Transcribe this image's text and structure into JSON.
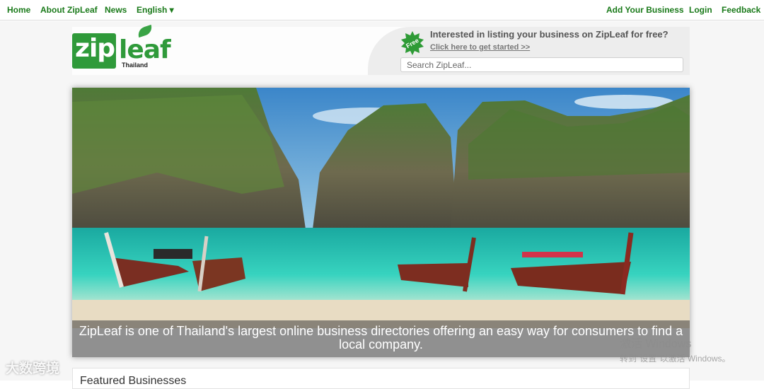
{
  "nav": {
    "home": "Home",
    "about": "About ZipLeaf",
    "news": "News",
    "language": "English ▾",
    "add_business": "Add Your Business",
    "login": "Login",
    "feedback": "Feedback"
  },
  "logo": {
    "zip": "zip",
    "leaf": "leaf",
    "country": "Thailand"
  },
  "promo": {
    "badge": "Free",
    "title": "Interested in listing your business on ZipLeaf for free?",
    "link": "Click here to get started >>",
    "search_placeholder": "Search ZipLeaf..."
  },
  "hero": {
    "caption": "ZipLeaf is one of Thailand's largest online business directories offering an easy way for consumers to find a local company."
  },
  "featured": {
    "title": "Featured Businesses"
  },
  "os_overlay": {
    "activate_title": "激活 Windows",
    "activate_sub": "转到\"设置\"以激活 Windows。",
    "watermark": "大数跨境"
  },
  "colors": {
    "brand_green": "#2f9a3a",
    "nav_green": "#1a7a1a"
  }
}
